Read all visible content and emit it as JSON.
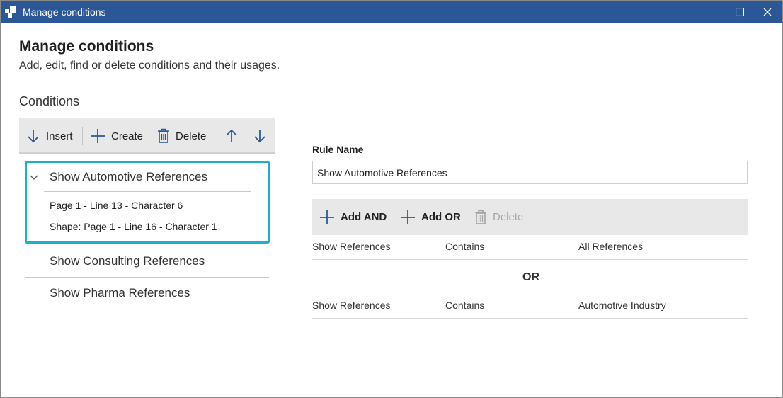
{
  "window": {
    "title": "Manage conditions",
    "icons": {
      "app": "app-icon",
      "maximize": "maximize-icon",
      "close": "close-icon"
    },
    "accent": "#2b5797"
  },
  "header": {
    "title": "Manage conditions",
    "subtitle": "Add, edit, find or delete conditions and their usages."
  },
  "conditions": {
    "section_label": "Conditions",
    "toolbar": {
      "insert": "Insert",
      "create": "Create",
      "delete": "Delete",
      "icons": [
        "arrow-down-icon",
        "plus-icon",
        "trash-icon",
        "arrow-up-icon",
        "arrow-down-icon"
      ]
    },
    "selected": {
      "title": "Show Automotive References",
      "expanded": true,
      "usages": [
        "Page 1 - Line 13 - Character 6",
        "Shape: Page 1 - Line 16 - Character 1"
      ]
    },
    "items": [
      "Show Consulting References",
      "Show Pharma References"
    ],
    "highlight_color": "#1eaecb"
  },
  "rule": {
    "name_label": "Rule Name",
    "name_value": "Show Automotive References",
    "toolbar": {
      "add_and": "Add AND",
      "add_or": "Add OR",
      "delete": "Delete",
      "delete_enabled": false
    },
    "rows": [
      {
        "field": "Show References",
        "operator": "Contains",
        "value": "All References"
      },
      {
        "field": "Show References",
        "operator": "Contains",
        "value": "Automotive Industry"
      }
    ],
    "separator": "OR"
  }
}
